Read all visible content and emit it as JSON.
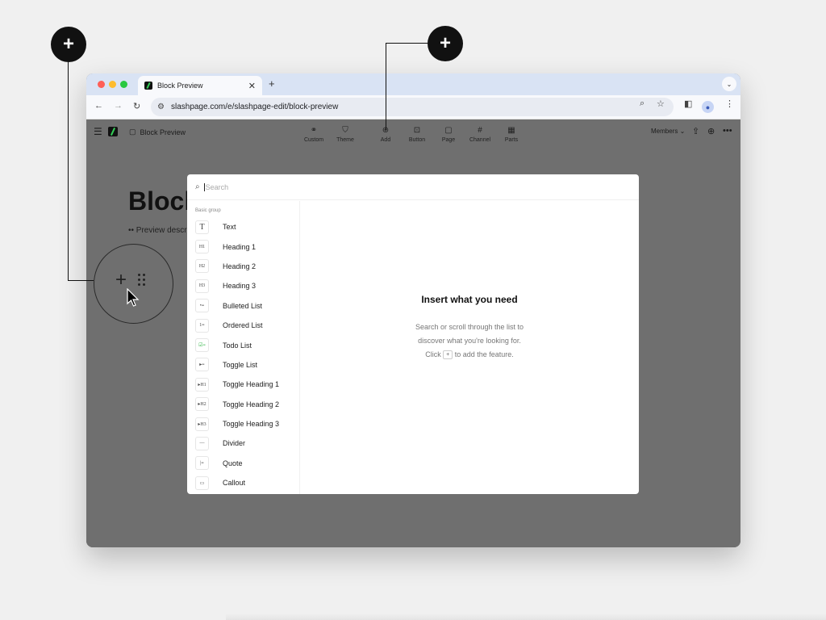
{
  "browser": {
    "tab_title": "Block Preview",
    "tab_close": "✕",
    "new_tab": "+",
    "tab_dropdown": "⌄",
    "url": "slashpage.com/e/slashpage-edit/block-preview",
    "colors": {
      "close": "#ff5f57",
      "minimize": "#febc2e",
      "maximize": "#28c840"
    }
  },
  "app": {
    "breadcrumb": "Block Preview",
    "tools": [
      {
        "icon": "⚭",
        "label": "Custom"
      },
      {
        "icon": "⛉",
        "label": "Theme"
      },
      {
        "icon": "⊕",
        "label": "Add"
      },
      {
        "icon": "⊡",
        "label": "Button"
      },
      {
        "icon": "▢",
        "label": "Page"
      },
      {
        "icon": "#",
        "label": "Channel"
      },
      {
        "icon": "▦",
        "label": "Parts"
      }
    ],
    "members": "Members ⌄",
    "page_title": "Block",
    "page_desc": "•• Preview description"
  },
  "callouts": {
    "plus": "+"
  },
  "modal": {
    "search_placeholder": "Search",
    "group_label": "Basic group",
    "items": [
      {
        "icon": "T",
        "label": "Text"
      },
      {
        "icon": "H1",
        "label": "Heading 1"
      },
      {
        "icon": "H2",
        "label": "Heading 2"
      },
      {
        "icon": "H3",
        "label": "Heading 3"
      },
      {
        "icon": "•≡",
        "label": "Bulleted List"
      },
      {
        "icon": "1≡",
        "label": "Ordered List"
      },
      {
        "icon": "☑≡",
        "label": "Todo List"
      },
      {
        "icon": "▸≡",
        "label": "Toggle List"
      },
      {
        "icon": "▸H1",
        "label": "Toggle Heading 1"
      },
      {
        "icon": "▸H2",
        "label": "Toggle Heading 2"
      },
      {
        "icon": "▸H3",
        "label": "Toggle Heading 3"
      },
      {
        "icon": "—",
        "label": "Divider"
      },
      {
        "icon": "|≡",
        "label": "Quote"
      },
      {
        "icon": "▭",
        "label": "Callout"
      }
    ],
    "empty_title": "Insert what you need",
    "empty_line1": "Search or scroll through the list to",
    "empty_line2": "discover what you're looking for.",
    "empty_click": "Click",
    "empty_key": "+",
    "empty_tail": "to add the feature."
  }
}
